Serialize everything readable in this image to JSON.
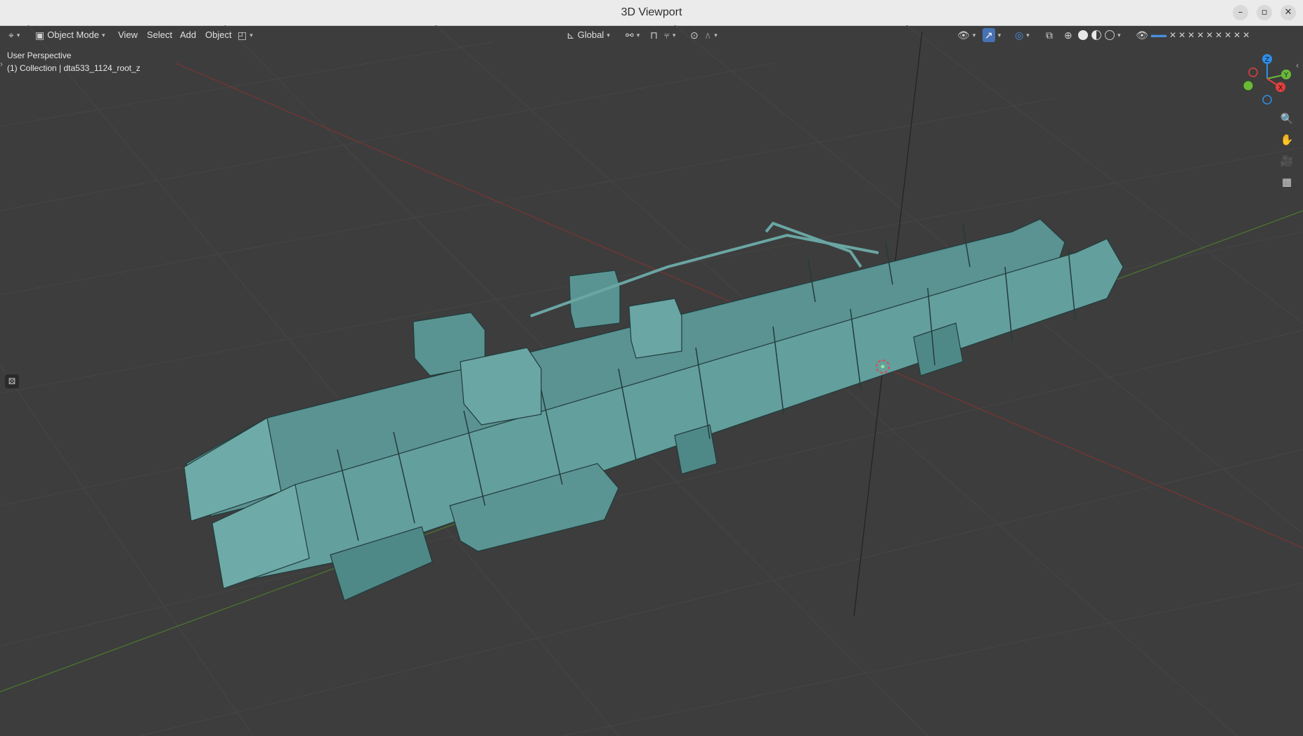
{
  "window": {
    "title": "3D Viewport",
    "controls": [
      "–",
      "▫",
      "✕"
    ]
  },
  "header": {
    "editor_type_icon": "editor-type-icon",
    "mode_label": "Object Mode",
    "menus": [
      "View",
      "Select",
      "Add",
      "Object"
    ],
    "transform_orientation": "Global",
    "icons": {
      "pivot": "pivot-icon",
      "snap": "snap-icon",
      "proportional": "proportional-icon",
      "visibility": "visibility-icon",
      "gizmo": "gizmo-icon",
      "overlay": "overlay-icon",
      "xray": "xray-icon"
    }
  },
  "overlay": {
    "view_name": "User Perspective",
    "collection_info": "(1) Collection | dta533_1124_root_z"
  },
  "gizmo": {
    "axes": [
      "Z",
      "Y",
      "X"
    ],
    "colors": {
      "x": "#e0413d",
      "y": "#6ab93b",
      "z": "#2f8ee6"
    }
  },
  "nav_tools": [
    "zoom-icon",
    "hand-pan-icon",
    "camera-icon",
    "ortho-grid-icon"
  ],
  "colors": {
    "viewport_bg": "#3d3d3d",
    "model_fill": "#5f9a98",
    "grid": "#4a4a4a",
    "x_axis": "#8a3a3a",
    "y_axis": "#4f7a2f"
  }
}
